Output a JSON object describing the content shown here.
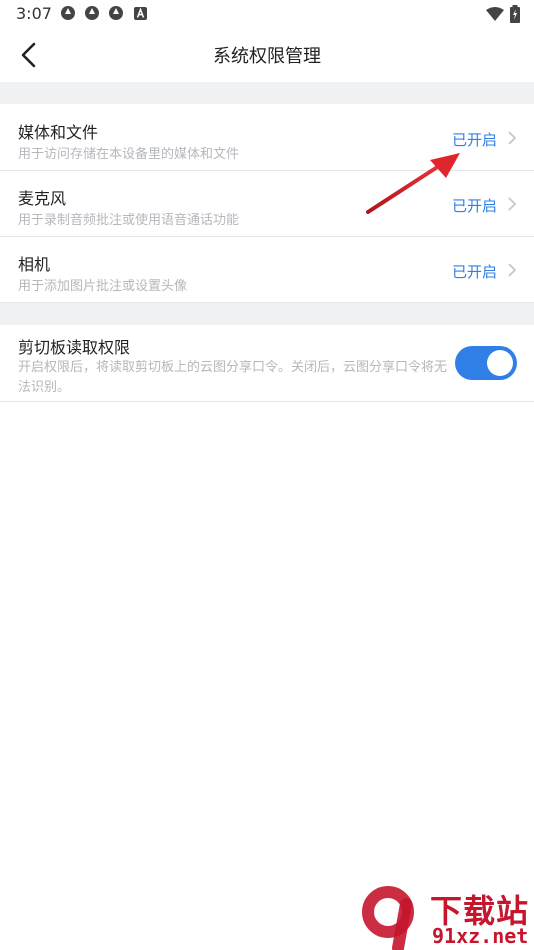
{
  "status_bar": {
    "time": "3:07",
    "icons": [
      "aperture-icon",
      "aperture-icon",
      "aperture-icon",
      "font-a-icon"
    ],
    "right_icons": [
      "wifi-icon",
      "battery-charging-icon"
    ]
  },
  "header": {
    "title": "系统权限管理",
    "back_icon": "chevron-left-icon"
  },
  "permissions": [
    {
      "label": "媒体和文件",
      "desc": "用于访问存储在本设备里的媒体和文件",
      "status": "已开启"
    },
    {
      "label": "麦克风",
      "desc": "用于录制音频批注或使用语音通话功能",
      "status": "已开启"
    },
    {
      "label": "相机",
      "desc": "用于添加图片批注或设置头像",
      "status": "已开启"
    }
  ],
  "clipboard": {
    "label": "剪切板读取权限",
    "desc": "开启权限后，将读取剪切板上的云图分享口令。关闭后，云图分享口令将无法识别。",
    "enabled": true
  },
  "annotation": {
    "arrow_color": "#d9232d"
  },
  "watermark": {
    "logo_text": "9",
    "title": "下载站",
    "site": "91xz.net"
  },
  "colors": {
    "accent": "#2f7fe6",
    "divider_bg": "#f0f1f3"
  }
}
